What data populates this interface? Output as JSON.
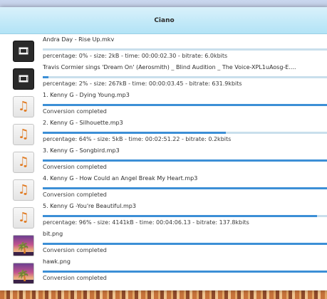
{
  "window": {
    "title": "Ciano"
  },
  "items": [
    {
      "icon": "video-file-icon",
      "name": "Andra Day - Rise Up.mkv",
      "progress": 0,
      "status": "percentage: 0% - size: 2kB - time: 00:00:02.30 - bitrate: 6.0kbits"
    },
    {
      "icon": "video-file-icon",
      "name": "Travis Cormier sings 'Dream On' (Aerosmith) _ Blind Audition _ The Voice-XPL1uAosg-E....",
      "progress": 2,
      "status": "percentage: 2% - size: 267kB - time: 00:00:03.45 - bitrate: 631.9kbits"
    },
    {
      "icon": "audio-file-icon",
      "name": "1. Kenny G - Dying Young.mp3",
      "progress": 100,
      "status": "Conversion completed"
    },
    {
      "icon": "audio-file-icon",
      "name": "2. Kenny G - Silhouette.mp3",
      "progress": 64,
      "status": "percentage: 64% - size: 5kB - time: 00:02:51.22 - bitrate: 0.2kbits"
    },
    {
      "icon": "audio-file-icon",
      "name": "3. Kenny G - Songbird.mp3",
      "progress": 100,
      "status": "Conversion completed"
    },
    {
      "icon": "audio-file-icon",
      "name": "4. Kenny G - How Could an Angel Break My Heart.mp3",
      "progress": 100,
      "status": "Conversion completed"
    },
    {
      "icon": "audio-file-icon",
      "name": "5. Kenny G -You're Beautiful.mp3",
      "progress": 96,
      "status": "percentage: 96% - size: 4141kB - time: 00:04:06.13 - bitrate: 137.8kbits"
    },
    {
      "icon": "image-file-icon",
      "name": "bit.png",
      "progress": 100,
      "status": "Conversion completed"
    },
    {
      "icon": "image-file-icon",
      "name": "hawk.png",
      "progress": 100,
      "status": "Conversion completed"
    }
  ],
  "colors": {
    "progress_fill": "#3c8fd6",
    "progress_track": "#c9dfec",
    "titlebar": "#b2e3f6"
  }
}
